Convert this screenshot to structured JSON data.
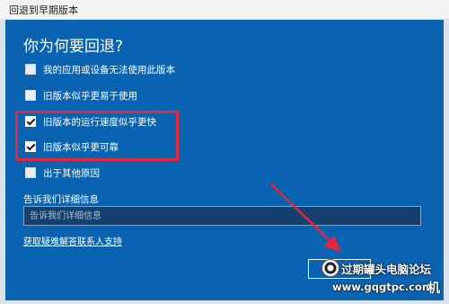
{
  "window": {
    "title": "回退到早期版本"
  },
  "dialog": {
    "heading": "你为何要回退?",
    "reasons": [
      {
        "label": "我的应用或设备无法使用此版本",
        "checked": false
      },
      {
        "label": "旧版本似乎更易于使用",
        "checked": false
      },
      {
        "label": "旧版本的运行速度似乎更快",
        "checked": true
      },
      {
        "label": "旧版本似乎更可靠",
        "checked": true
      },
      {
        "label": "出于其他原因",
        "checked": false
      }
    ],
    "details_label": "告诉我们详细信息",
    "details_placeholder": "告诉我们详细信息",
    "help_link": "获取疑难解答联系人支持"
  },
  "watermark": {
    "name": "过期罐头电脑论坛",
    "url": "www.gqgtpc.com",
    "corner": "机"
  },
  "colors": {
    "dialog_bg": "#0a63b1",
    "highlight": "#e2273a",
    "arrow": "#e2273a"
  }
}
